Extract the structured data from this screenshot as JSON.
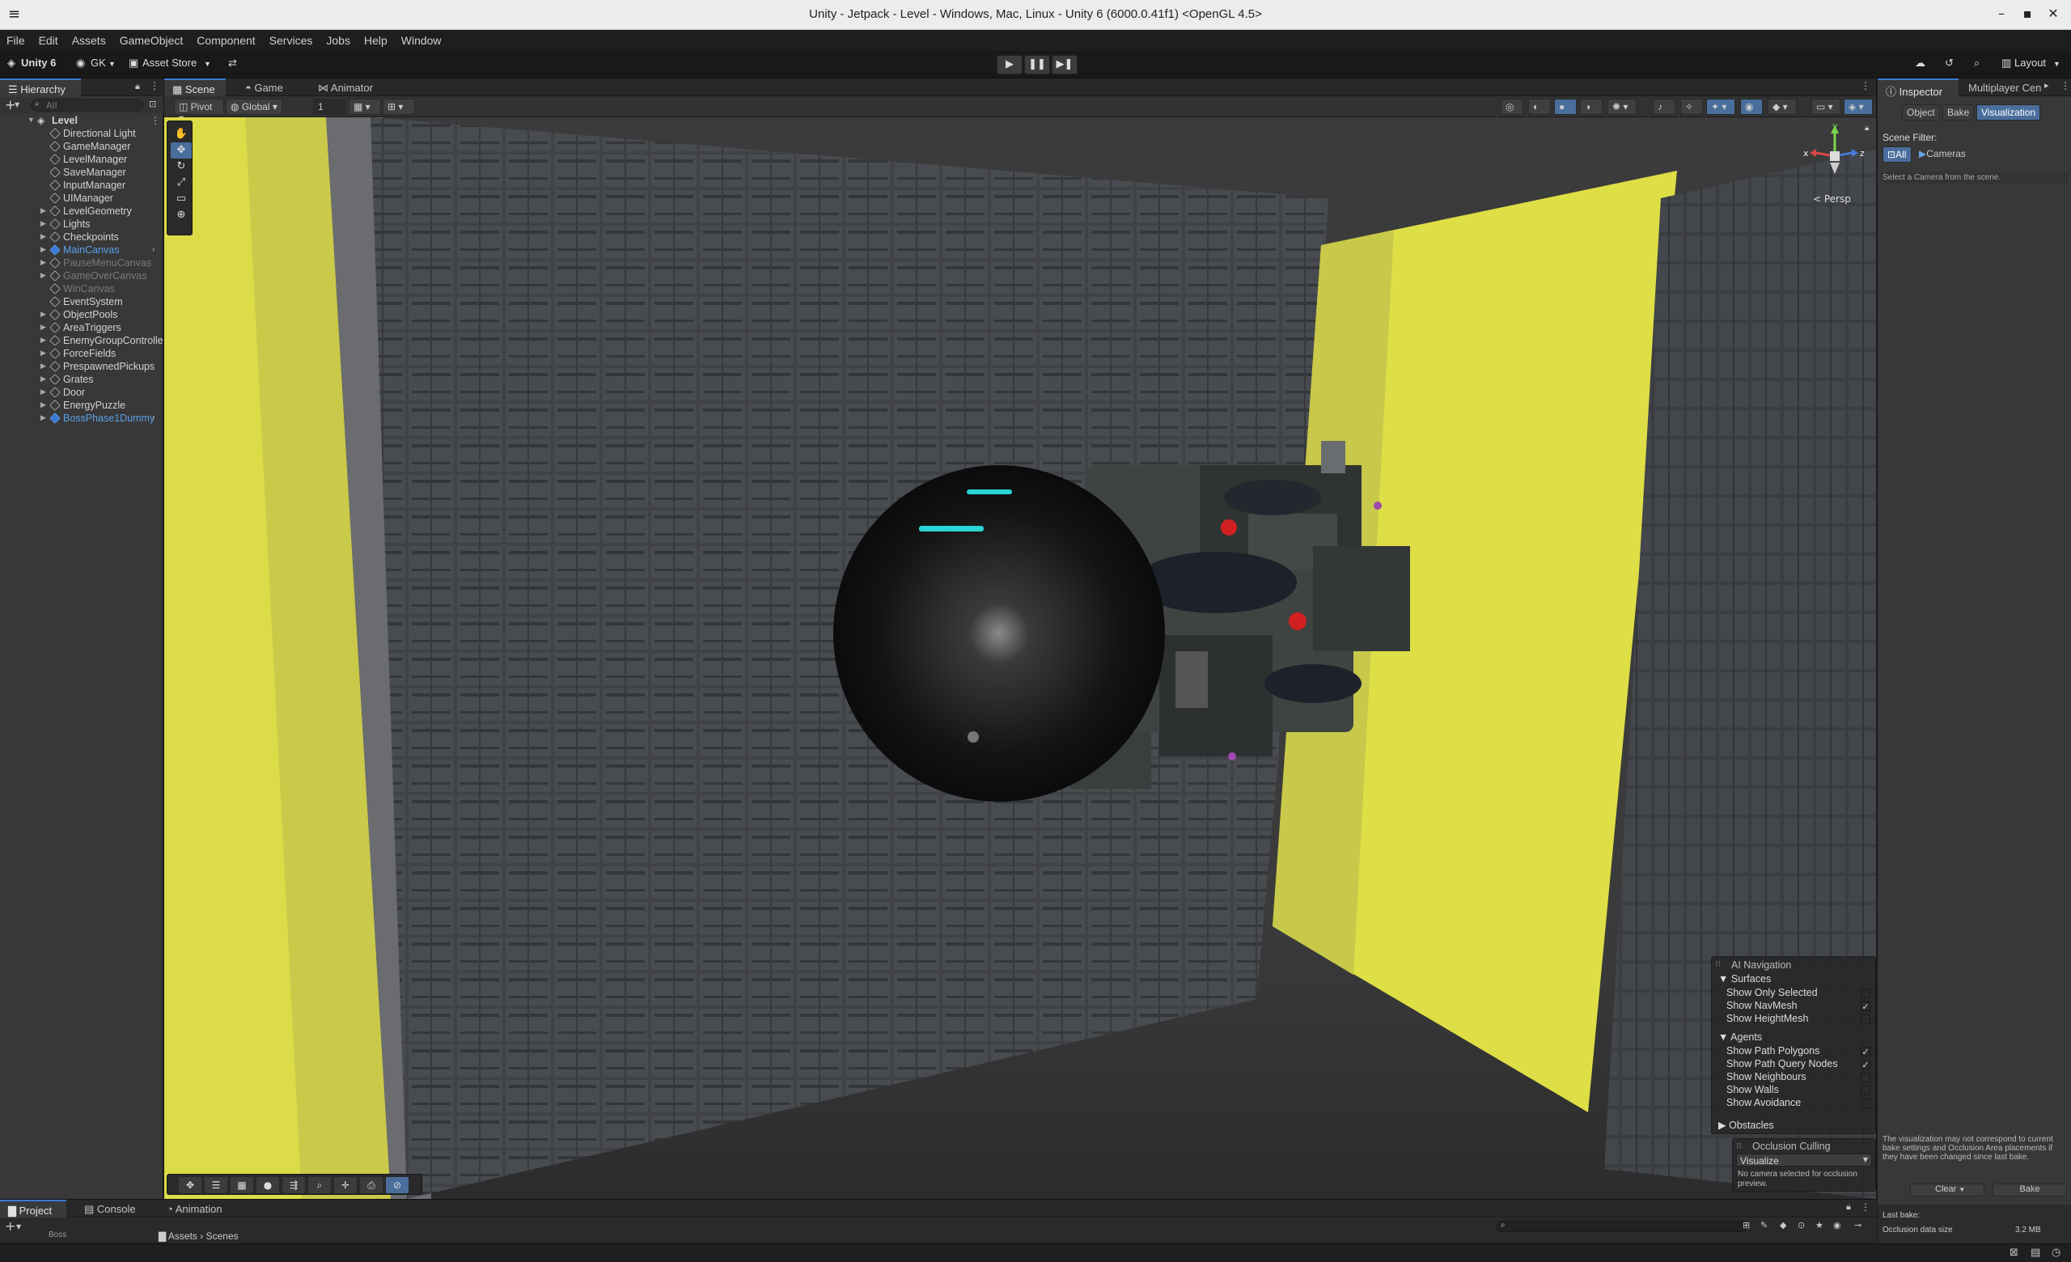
{
  "window": {
    "title": "Unity - Jetpack - Level - Windows, Mac, Linux - Unity 6 (6000.0.41f1) <OpenGL 4.5>"
  },
  "menu": [
    "File",
    "Edit",
    "Assets",
    "GameObject",
    "Component",
    "Services",
    "Jobs",
    "Help",
    "Window"
  ],
  "toolbar": {
    "unity_label": "Unity 6",
    "account": "GK",
    "asset_store": "Asset Store",
    "layout": "Layout"
  },
  "hierarchy": {
    "tab": "Hierarchy",
    "search_placeholder": "All",
    "root": "Level",
    "items": [
      {
        "label": "Directional Light",
        "expand": false,
        "state": "normal",
        "prefab": false
      },
      {
        "label": "GameManager",
        "expand": false,
        "state": "normal",
        "prefab": false
      },
      {
        "label": "LevelManager",
        "expand": false,
        "state": "normal",
        "prefab": false
      },
      {
        "label": "SaveManager",
        "expand": false,
        "state": "normal",
        "prefab": false
      },
      {
        "label": "InputManager",
        "expand": false,
        "state": "normal",
        "prefab": false
      },
      {
        "label": "UIManager",
        "expand": false,
        "state": "normal",
        "prefab": false
      },
      {
        "label": "LevelGeometry",
        "expand": true,
        "state": "normal",
        "prefab": false
      },
      {
        "label": "Lights",
        "expand": true,
        "state": "normal",
        "prefab": false
      },
      {
        "label": "Checkpoints",
        "expand": true,
        "state": "normal",
        "prefab": false
      },
      {
        "label": "MainCanvas",
        "expand": true,
        "state": "blue",
        "prefab": true
      },
      {
        "label": "PauseMenuCanvas",
        "expand": true,
        "state": "dim",
        "prefab": false
      },
      {
        "label": "GameOverCanvas",
        "expand": true,
        "state": "dim",
        "prefab": false
      },
      {
        "label": "WinCanvas",
        "expand": false,
        "state": "dim",
        "prefab": false
      },
      {
        "label": "EventSystem",
        "expand": false,
        "state": "normal",
        "prefab": false
      },
      {
        "label": "ObjectPools",
        "expand": true,
        "state": "normal",
        "prefab": false
      },
      {
        "label": "AreaTriggers",
        "expand": true,
        "state": "normal",
        "prefab": false
      },
      {
        "label": "EnemyGroupControlle",
        "expand": true,
        "state": "normal",
        "prefab": false
      },
      {
        "label": "ForceFields",
        "expand": true,
        "state": "normal",
        "prefab": false
      },
      {
        "label": "PrespawnedPickups",
        "expand": true,
        "state": "normal",
        "prefab": false
      },
      {
        "label": "Grates",
        "expand": true,
        "state": "normal",
        "prefab": false
      },
      {
        "label": "Door",
        "expand": true,
        "state": "normal",
        "prefab": false
      },
      {
        "label": "EnergyPuzzle",
        "expand": true,
        "state": "normal",
        "prefab": false
      },
      {
        "label": "BossPhase1Dummy",
        "expand": true,
        "state": "blue",
        "prefab": true
      }
    ]
  },
  "scene": {
    "tabs": [
      "Scene",
      "Game",
      "Animator"
    ],
    "pivot": "Pivot",
    "global": "Global",
    "grid_value": "1",
    "persp": "< Persp",
    "gizmo_axes": {
      "x": "x",
      "y": "y",
      "z": "z"
    }
  },
  "ai_nav": {
    "title": "AI Navigation",
    "surfaces": "Surfaces",
    "surface_items": [
      {
        "label": "Show Only Selected",
        "checked": false
      },
      {
        "label": "Show NavMesh",
        "checked": true
      },
      {
        "label": "Show HeightMesh",
        "checked": false
      }
    ],
    "agents": "Agents",
    "agent_items": [
      {
        "label": "Show Path Polygons",
        "checked": true
      },
      {
        "label": "Show Path Query Nodes",
        "checked": true
      },
      {
        "label": "Show Neighbours",
        "checked": false
      },
      {
        "label": "Show Walls",
        "checked": false
      },
      {
        "label": "Show Avoidance",
        "checked": false
      }
    ],
    "obstacles": "Obstacles"
  },
  "occlusion": {
    "title": "Occlusion Culling",
    "mode": "Visualize",
    "message": "No camera selected for occlusion preview."
  },
  "inspector": {
    "tabs": [
      "Inspector",
      "Multiplayer Cen"
    ],
    "subtabs": [
      "Object",
      "Bake",
      "Visualization"
    ],
    "scene_filter": "Scene Filter:",
    "filter_all": "All",
    "filter_cameras": "Cameras",
    "hint": "Select a Camera from the scene.",
    "warning": "The visualization may not correspond to current bake settings and Occlusion Area placements if they have been changed since last bake.",
    "clear": "Clear",
    "bake": "Bake",
    "last_bake": "Last bake:",
    "data_size_label": "Occlusion data size",
    "data_size_value": "3.2 MB"
  },
  "bottom": {
    "tabs": [
      "Project",
      "Console",
      "Animation"
    ],
    "breadcrumb": [
      "Assets",
      "Scenes"
    ],
    "folder": "Boss"
  },
  "colors": {
    "accent": "#3a7ad6",
    "yellow": "#e6e64a"
  }
}
